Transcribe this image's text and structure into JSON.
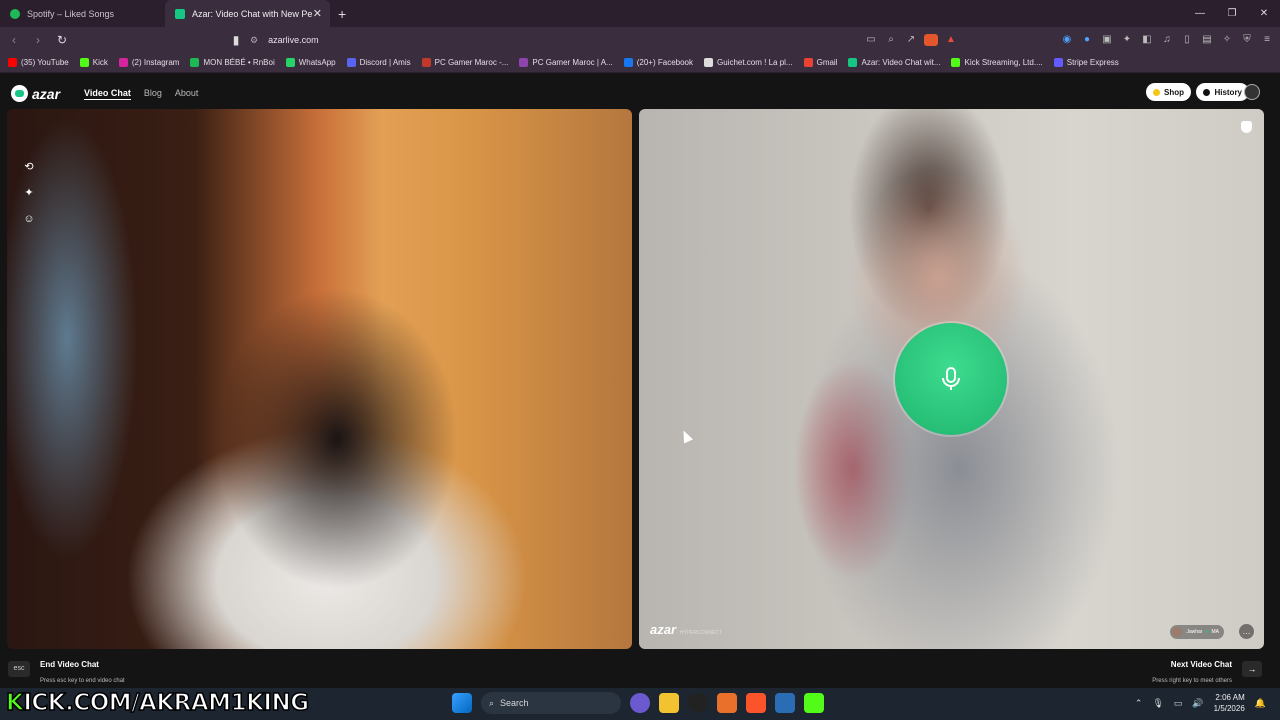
{
  "browser": {
    "tabs": [
      {
        "label": "Spotify – Liked Songs",
        "color": "#1db954"
      },
      {
        "label": "Azar: Video Chat with New Pe",
        "color": "#16c784"
      }
    ],
    "url": "azarlive.com",
    "bookmarks": [
      {
        "label": "(35) YouTube",
        "color": "#ff0000"
      },
      {
        "label": "Kick",
        "color": "#53fc18"
      },
      {
        "label": "(2) Instagram",
        "color": "#d6249f"
      },
      {
        "label": "MON BÉBÉ • RnBoi",
        "color": "#1db954"
      },
      {
        "label": "WhatsApp",
        "color": "#25d366"
      },
      {
        "label": "Discord | Amis",
        "color": "#5865f2"
      },
      {
        "label": "PC Gamer Maroc -...",
        "color": "#c0392b"
      },
      {
        "label": "PC Gamer Maroc | A...",
        "color": "#8e44ad"
      },
      {
        "label": "(20+) Facebook",
        "color": "#1877f2"
      },
      {
        "label": "Guichet.com ! La pl...",
        "color": "#dddddd"
      },
      {
        "label": "Gmail",
        "color": "#ea4335"
      },
      {
        "label": "Azar: Video Chat wit...",
        "color": "#16c784"
      },
      {
        "label": "Kick Streaming, Ltd....",
        "color": "#53fc18"
      },
      {
        "label": "Stripe Express",
        "color": "#635bff"
      }
    ]
  },
  "site": {
    "logo": "azar",
    "nav": {
      "video_chat": "Video Chat",
      "blog": "Blog",
      "about": "About"
    },
    "shop_label": "Shop",
    "history_label": "History",
    "watermark": "azar",
    "watermark_sub": "HYPERCONNECT",
    "peer_name": "Jawhar",
    "peer_country": "MA",
    "end_key": "esc",
    "end_title": "End Video Chat",
    "end_hint": "Press esc key to end video chat",
    "next_title": "Next Video Chat",
    "next_hint": "Press right key to meet others"
  },
  "overlay": {
    "streamer_url": "KICK.COM/AKRAM1KING"
  },
  "taskbar": {
    "search_placeholder": "Search",
    "time": "2:06 AM",
    "date": "1/5/2026"
  }
}
